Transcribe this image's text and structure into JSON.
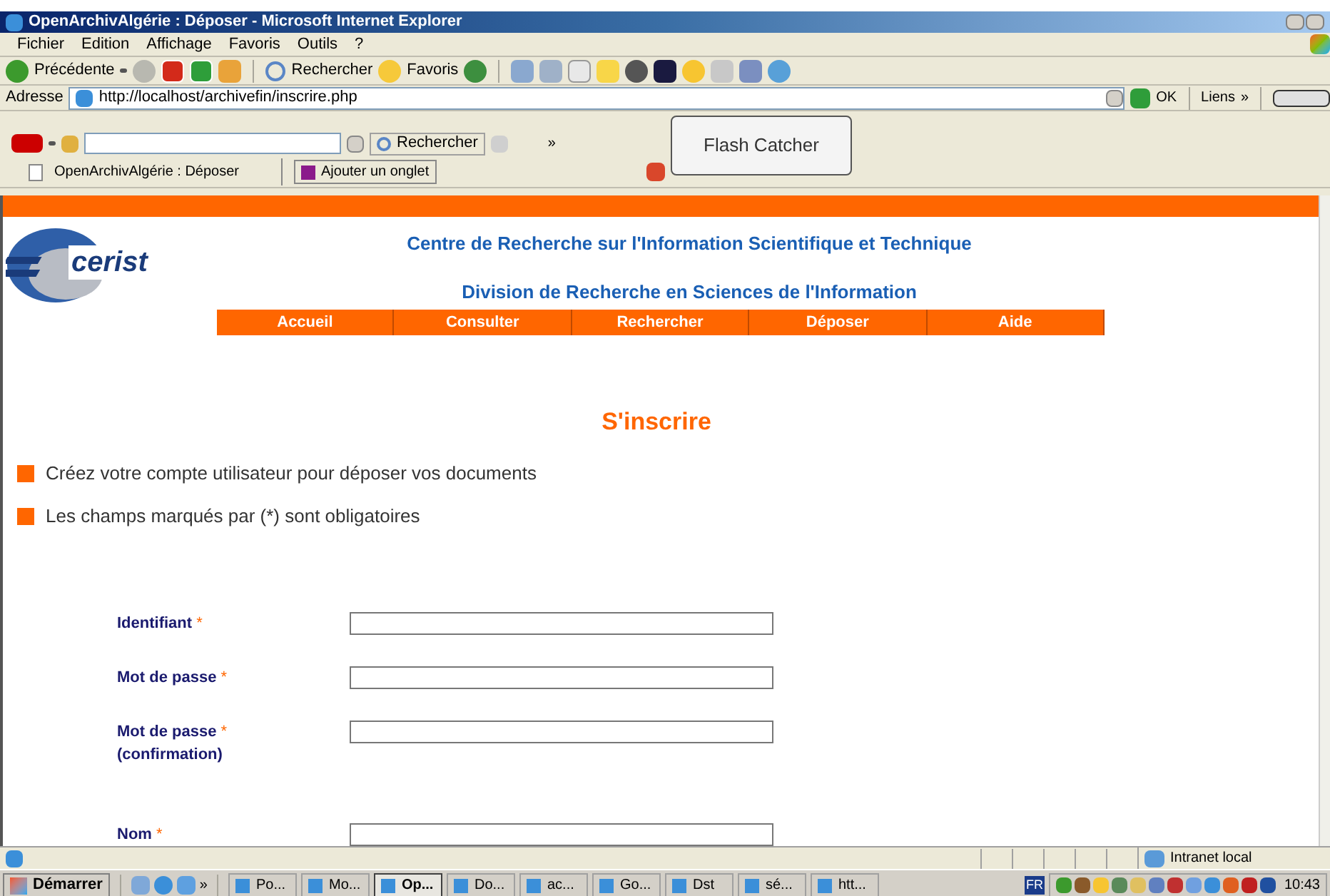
{
  "window": {
    "title": "OpenArchivAlgérie : Déposer - Microsoft Internet Explorer"
  },
  "menu": [
    "Fichier",
    "Edition",
    "Affichage",
    "Favoris",
    "Outils",
    "?"
  ],
  "toolbar": {
    "back": "Précédente",
    "search": "Rechercher",
    "favorites": "Favoris"
  },
  "address": {
    "label": "Adresse",
    "url": "http://localhost/archivefin/inscrire.php",
    "go": "OK",
    "links": "Liens",
    "links_more": "»"
  },
  "yahoo_bar": {
    "search": "Rechercher",
    "more": "»"
  },
  "tabs": [
    {
      "label": "OpenArchivAlgérie : Déposer",
      "selected": true
    }
  ],
  "new_tab": "Ajouter un onglet",
  "flash_button": "Flash Catcher",
  "page": {
    "logo": "cerist",
    "heading_1": "Centre de Recherche sur l'Information Scientifique et Technique",
    "heading_2": "Division de Recherche en Sciences de l'Information",
    "nav": [
      "Accueil",
      "Consulter",
      "Rechercher",
      "Déposer",
      "Aide"
    ],
    "title": "S'inscrire",
    "notes": [
      "Créez votre compte utilisateur pour déposer vos documents",
      "Les champs marqués par (*) sont obligatoires"
    ],
    "fields": [
      {
        "label": "Identifiant",
        "required": "*"
      },
      {
        "label": "Mot de passe",
        "required": "*"
      },
      {
        "label": "Mot de passe",
        "required": "*",
        "sub": "(confirmation)"
      },
      {
        "label": "Nom",
        "required": "*"
      }
    ]
  },
  "status_bar": {
    "zone": "Intranet local"
  },
  "taskbar": {
    "start": "Démarrer",
    "more": "»",
    "items": [
      {
        "label": "Po...",
        "selected": false
      },
      {
        "label": "Mo...",
        "selected": false
      },
      {
        "label": "Op...",
        "selected": true
      },
      {
        "label": "Do...",
        "selected": false
      },
      {
        "label": "ac...",
        "selected": false
      },
      {
        "label": "Go...",
        "selected": false
      },
      {
        "label": "Dst",
        "selected": false
      },
      {
        "label": "sé...",
        "selected": false
      },
      {
        "label": "htt...",
        "selected": false
      }
    ],
    "lang": "FR",
    "clock": "10:43"
  }
}
